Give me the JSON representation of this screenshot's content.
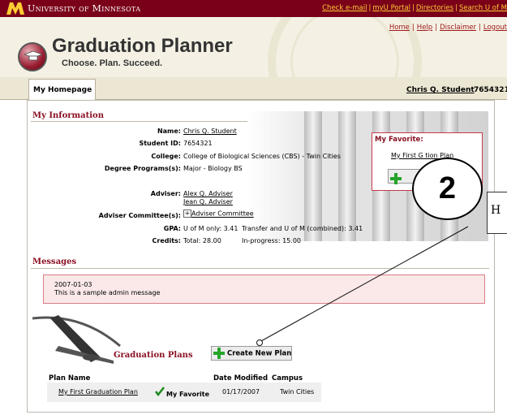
{
  "topbar": {
    "university": "University of Minnesota",
    "links": [
      "Check e-mail",
      "myU Portal",
      "Directories",
      "Search U of M"
    ]
  },
  "header": {
    "title": "Graduation Planner",
    "tagline": "Choose. Plan. Succeed.",
    "links": [
      "Home",
      "Help",
      "Disclaimer",
      "Logout"
    ]
  },
  "tabs": {
    "home": "My Homepage"
  },
  "user": {
    "name": "Chris Q. Student",
    "id": "7654321"
  },
  "my_information": {
    "title": "My Information",
    "name_label": "Name:",
    "name_value": "Chris Q. Student",
    "student_id_label": "Student ID:",
    "student_id_value": "7654321",
    "college_label": "College:",
    "college_value": "College of Biological Sciences (CBS) - Twin Cities",
    "degree_label": "Degree Programs(s):",
    "degree_value": "Major - Biology BS",
    "adviser_label": "Adviser:",
    "adviser_1": "Alex Q. Adviser",
    "adviser_2": "Jean Q. Adviser",
    "committee_label": "Adviser Committee(s):",
    "committee_value": "Adviser Committee",
    "gpa_label": "GPA:",
    "gpa_umn": "U of M only: 3.41",
    "gpa_combined": "Transfer and U of M (combined): 3.41",
    "credits_label": "Credits:",
    "credits_total": "Total: 28.00",
    "credits_inprogress": "In-progress: 15.00"
  },
  "favorite": {
    "title": "My Favorite:",
    "plan": "My First G    tion Plan"
  },
  "messages": {
    "title": "Messages",
    "date": "2007-01-03",
    "text": "This is a sample admin message"
  },
  "plans": {
    "title": "Graduation Plans",
    "create_label": "Create New Plan",
    "headers": {
      "name": "Plan Name",
      "date": "Date Modified",
      "campus": "Campus"
    },
    "rows": [
      {
        "name": "My First Graduation Plan",
        "favorite": "My Favorite",
        "date": "01/17/2007",
        "campus": "Twin Cities"
      }
    ]
  },
  "annotation": {
    "number": "2",
    "callout_text": "H"
  }
}
